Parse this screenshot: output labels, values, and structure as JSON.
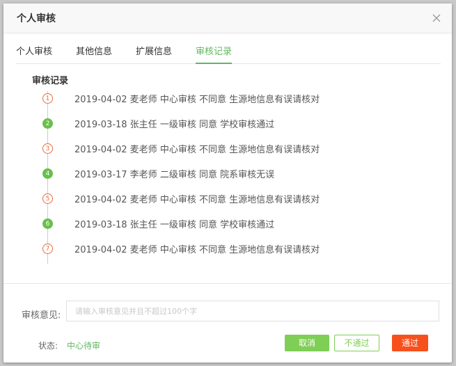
{
  "dialog": {
    "title": "个人审核"
  },
  "tabs": [
    {
      "label": "个人审核",
      "active": false
    },
    {
      "label": "其他信息",
      "active": false
    },
    {
      "label": "扩展信息",
      "active": false
    },
    {
      "label": "审核记录",
      "active": true
    }
  ],
  "records": {
    "section_title": "审核记录",
    "items": [
      {
        "num": "1",
        "status": "reject",
        "text": "2019-04-02 麦老师 中心审核 不同意 生源地信息有误请核对"
      },
      {
        "num": "2",
        "status": "pass",
        "text": "2019-03-18 张主任 一级审核 同意 学校审核通过"
      },
      {
        "num": "3",
        "status": "reject",
        "text": "2019-04-02 麦老师 中心审核 不同意 生源地信息有误请核对"
      },
      {
        "num": "4",
        "status": "pass",
        "text": "2019-03-17 李老师 二级审核 同意 院系审核无误"
      },
      {
        "num": "5",
        "status": "reject",
        "text": "2019-04-02 麦老师 中心审核 不同意 生源地信息有误请核对"
      },
      {
        "num": "6",
        "status": "pass",
        "text": "2019-03-18 张主任 一级审核 同意 学校审核通过"
      },
      {
        "num": "7",
        "status": "reject",
        "text": "2019-04-02 麦老师 中心审核 不同意 生源地信息有误请核对"
      }
    ]
  },
  "footer": {
    "opinion_label": "审核意见:",
    "opinion_value": "",
    "opinion_placeholder": "请输入审核意见并且不超过100个字",
    "status_label": "状态:",
    "status_value": "中心待审",
    "cancel_label": "取消",
    "reject_label": "不通过",
    "approve_label": "通过"
  },
  "colors": {
    "accent_green": "#5fb85f",
    "pass_green": "#6abf4b",
    "reject_orange": "#e86a3b",
    "approve_red": "#f6511d"
  }
}
